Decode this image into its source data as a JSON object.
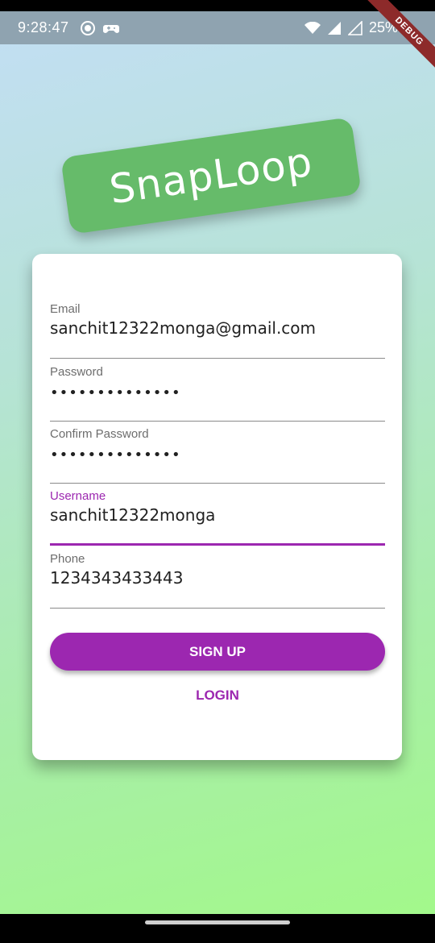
{
  "status_bar": {
    "time": "9:28:47",
    "battery": "25%",
    "icons": [
      "record-icon",
      "game-controller-icon",
      "wifi-icon",
      "signal-icon",
      "battery-icon"
    ]
  },
  "debug_banner": "DEBUG",
  "logo": {
    "text": "SnapLoop",
    "color": "#66bb6a"
  },
  "form": {
    "email": {
      "label": "Email",
      "value": "sanchit12322monga@gmail.com"
    },
    "password": {
      "label": "Password",
      "value": "••••••••••••••"
    },
    "confirm_password": {
      "label": "Confirm Password",
      "value": "••••••••••••••"
    },
    "username": {
      "label": "Username",
      "value": "sanchit12322monga"
    },
    "phone": {
      "label": "Phone",
      "value": "1234343433443"
    }
  },
  "buttons": {
    "signup": "SIGN UP",
    "login": "LOGIN"
  },
  "colors": {
    "accent": "#9c27b0",
    "logo": "#66bb6a"
  }
}
